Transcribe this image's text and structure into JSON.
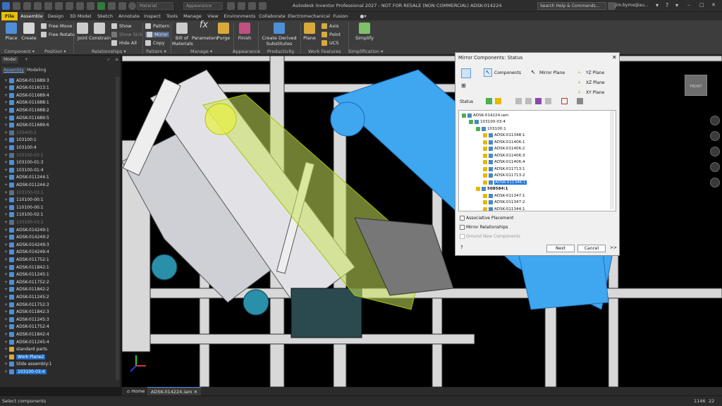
{
  "titlebar": {
    "title": "Autodesk Inventor Professional 2027 - NOT FOR RESALE (NON COMMERCIAL)    ADSK-014224",
    "material_placeholder": "Material",
    "appearance_placeholder": "Appearance",
    "search_placeholder": "Search Help & Commands...",
    "user": "jim.byrne@au..."
  },
  "ribbon_tabs": [
    "File",
    "Assemble",
    "Design",
    "3D Model",
    "Sketch",
    "Annotate",
    "Inspect",
    "Tools",
    "Manage",
    "View",
    "Environments",
    "Collaborate",
    "Electromechanical",
    "Fusion"
  ],
  "ribbon": {
    "place": "Place",
    "create": "Create",
    "free_move": "Free Move",
    "free_rotate": "Free Rotate",
    "joint": "Joint",
    "constrain": "Constrain",
    "show": "Show",
    "show_sick": "Show Sick",
    "hide_all": "Hide All",
    "pattern": "Pattern",
    "mirror": "Mirror",
    "copy": "Copy",
    "bom": "Bill of Materials",
    "parameters": "Parameters",
    "purge": "Purge",
    "finish": "Finish",
    "create_derived": "Create Derived Substitutes",
    "plane": "Plane",
    "axis": "Axis",
    "point": "Point",
    "ucs": "UCS",
    "simplify": "Simplify",
    "panels": {
      "component": "Component ▾",
      "position": "Position ▾",
      "relationships": "Relationships ▾",
      "pattern": "Pattern ▾",
      "manage": "Manage ▾",
      "appearance": "Appearance",
      "productivity": "Productivity",
      "work_features": "Work Features",
      "simplification": "Simplification ▾"
    }
  },
  "browser": {
    "model_label": "Model",
    "tab_assembly": "Assembly",
    "tab_modeling": "Modeling",
    "items": [
      {
        "label": "ADSK-011689:3",
        "dim": false
      },
      {
        "label": "ADSK-011613:1",
        "dim": false
      },
      {
        "label": "ADSK-011689:4",
        "dim": false
      },
      {
        "label": "ADSK-011688:1",
        "dim": false
      },
      {
        "label": "ADSK-011688:2",
        "dim": false
      },
      {
        "label": "ADSK-011689:5",
        "dim": false
      },
      {
        "label": "ADSK-011689:6",
        "dim": false
      },
      {
        "label": "103400:2",
        "dim": true
      },
      {
        "label": "103100:1",
        "dim": false
      },
      {
        "label": "103100:4",
        "dim": false
      },
      {
        "label": "103100-03:1",
        "dim": true
      },
      {
        "label": "103100-01:3",
        "dim": false
      },
      {
        "label": "103100-01:4",
        "dim": false
      },
      {
        "label": "ADSK-011244:1",
        "dim": false
      },
      {
        "label": "ADSK-011244:2",
        "dim": false
      },
      {
        "label": "103100-03:1",
        "dim": true
      },
      {
        "label": "110100-00:1",
        "dim": false
      },
      {
        "label": "110100-00:1",
        "dim": false
      },
      {
        "label": "110100-02:1",
        "dim": false
      },
      {
        "label": "103100-03:2",
        "dim": true
      },
      {
        "label": "ADSK-014249:1",
        "dim": false
      },
      {
        "label": "ADSK-014249:2",
        "dim": false
      },
      {
        "label": "ADSK-014249:3",
        "dim": false
      },
      {
        "label": "ADSK-014249:4",
        "dim": false
      },
      {
        "label": "ADSK-011752:1",
        "dim": false
      },
      {
        "label": "ADSK-011842:1",
        "dim": false
      },
      {
        "label": "ADSK-011245:1",
        "dim": false
      },
      {
        "label": "ADSK-011752:2",
        "dim": false
      },
      {
        "label": "ADSK-011842:2",
        "dim": false
      },
      {
        "label": "ADSK-011245:2",
        "dim": false
      },
      {
        "label": "ADSK-011752:3",
        "dim": false
      },
      {
        "label": "ADSK-011842:3",
        "dim": false
      },
      {
        "label": "ADSK-011245:3",
        "dim": false
      },
      {
        "label": "ADSK-011752:4",
        "dim": false
      },
      {
        "label": "ADSK-011842:4",
        "dim": false
      },
      {
        "label": "ADSK-011245:4",
        "dim": false
      },
      {
        "label": "standard parts",
        "dim": false,
        "folder": true
      },
      {
        "label": "Work Plane2",
        "dim": false,
        "sel": true,
        "folder": true
      },
      {
        "label": "Slide assembly:1",
        "dim": false
      },
      {
        "label": "103100-03:4",
        "dim": false,
        "sel": true
      }
    ]
  },
  "dialog": {
    "title": "Mirror Components: Status",
    "components": "Components",
    "mirror_plane": "Mirror Plane",
    "yz_plane": "YZ Plane",
    "xz_plane": "XZ Plane",
    "xy_plane": "XY Plane",
    "status": "Status",
    "tree": [
      {
        "label": "ADSK-014224.iam",
        "indent": 0,
        "bold": false
      },
      {
        "label": "103100-03:4",
        "indent": 1
      },
      {
        "label": "103100:1",
        "indent": 2
      },
      {
        "label": "ADSK-011348:1",
        "indent": 3
      },
      {
        "label": "ADSK-011406:1",
        "indent": 3
      },
      {
        "label": "ADSK-011406:2",
        "indent": 3
      },
      {
        "label": "ADSK-011406:3",
        "indent": 3
      },
      {
        "label": "ADSK-011406:4",
        "indent": 3
      },
      {
        "label": "ADSK-011713:1",
        "indent": 3
      },
      {
        "label": "ADSK-011713:2",
        "indent": 3
      },
      {
        "label": "ADSK-011346:1",
        "indent": 3,
        "sel": true
      },
      {
        "label": "508584:1",
        "indent": 2,
        "bold": true
      },
      {
        "label": "ADSK-011347:1",
        "indent": 3
      },
      {
        "label": "ADSK-011347:2",
        "indent": 3
      },
      {
        "label": "ADSK-011344:1",
        "indent": 3
      }
    ],
    "associative_placement": "Associative Placement",
    "mirror_relationships": "Mirror Relationships",
    "ground_new": "Ground New Components",
    "next": "Next",
    "cancel": "Cancel",
    "more": ">>"
  },
  "viewcube": "FRONT",
  "doctabs": {
    "home": "Home",
    "doc": "ADSK-014224.iam"
  },
  "status": {
    "text": "Select components",
    "n1": "1146",
    "n2": "22"
  }
}
